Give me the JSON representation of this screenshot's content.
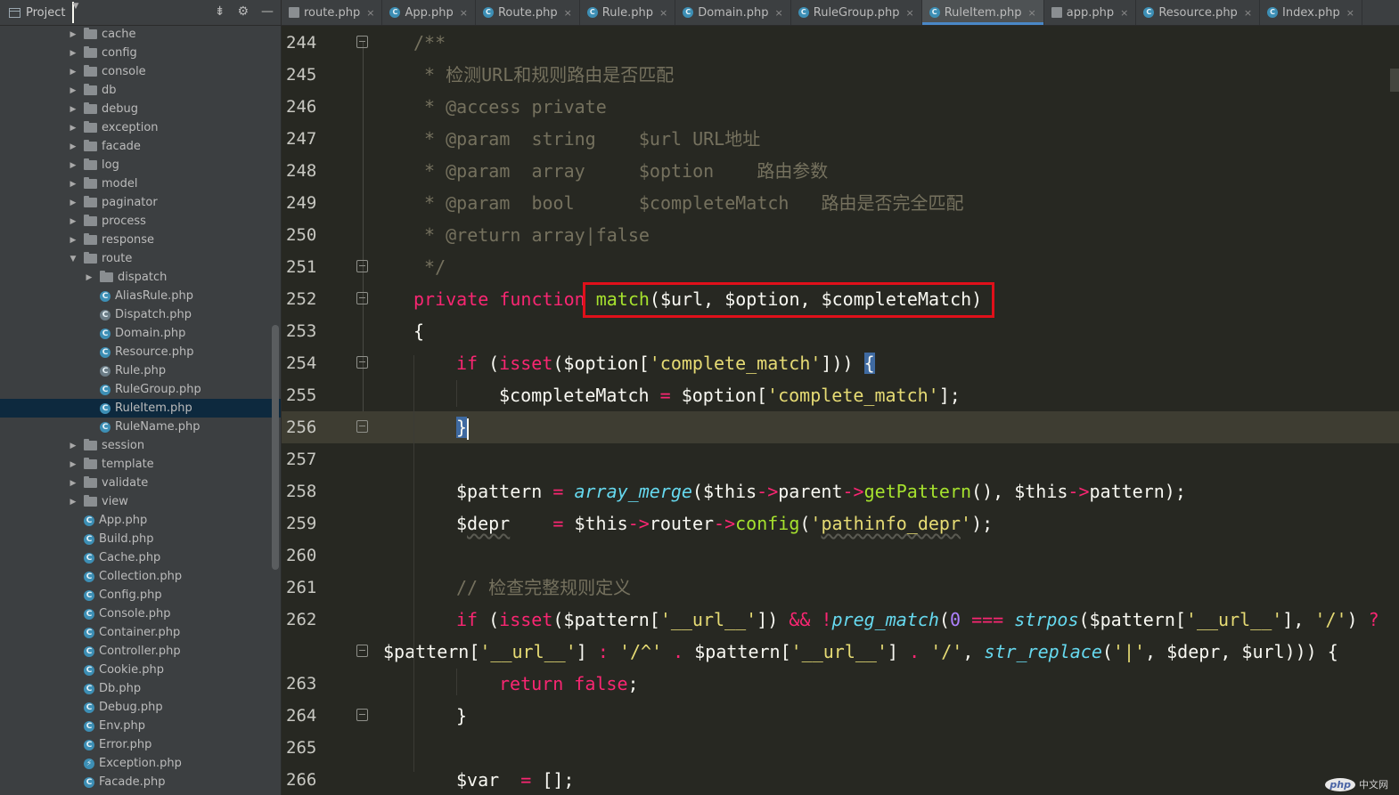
{
  "sidebar": {
    "title": "Project",
    "items": [
      {
        "type": "folder",
        "label": "cache",
        "indent": 1,
        "expanded": false
      },
      {
        "type": "folder",
        "label": "config",
        "indent": 1,
        "expanded": false
      },
      {
        "type": "folder",
        "label": "console",
        "indent": 1,
        "expanded": false
      },
      {
        "type": "folder",
        "label": "db",
        "indent": 1,
        "expanded": false
      },
      {
        "type": "folder",
        "label": "debug",
        "indent": 1,
        "expanded": false
      },
      {
        "type": "folder",
        "label": "exception",
        "indent": 1,
        "expanded": false
      },
      {
        "type": "folder",
        "label": "facade",
        "indent": 1,
        "expanded": false
      },
      {
        "type": "folder",
        "label": "log",
        "indent": 1,
        "expanded": false
      },
      {
        "type": "folder",
        "label": "model",
        "indent": 1,
        "expanded": false
      },
      {
        "type": "folder",
        "label": "paginator",
        "indent": 1,
        "expanded": false
      },
      {
        "type": "folder",
        "label": "process",
        "indent": 1,
        "expanded": false
      },
      {
        "type": "folder",
        "label": "response",
        "indent": 1,
        "expanded": false
      },
      {
        "type": "folder",
        "label": "route",
        "indent": 1,
        "expanded": true
      },
      {
        "type": "folder",
        "label": "dispatch",
        "indent": 2,
        "expanded": false
      },
      {
        "type": "class",
        "label": "AliasRule.php",
        "indent": 2
      },
      {
        "type": "abstract",
        "label": "Dispatch.php",
        "indent": 2
      },
      {
        "type": "class",
        "label": "Domain.php",
        "indent": 2
      },
      {
        "type": "class",
        "label": "Resource.php",
        "indent": 2
      },
      {
        "type": "abstract",
        "label": "Rule.php",
        "indent": 2
      },
      {
        "type": "class",
        "label": "RuleGroup.php",
        "indent": 2
      },
      {
        "type": "class",
        "label": "RuleItem.php",
        "indent": 2,
        "selected": true
      },
      {
        "type": "class",
        "label": "RuleName.php",
        "indent": 2
      },
      {
        "type": "folder",
        "label": "session",
        "indent": 1,
        "expanded": false
      },
      {
        "type": "folder",
        "label": "template",
        "indent": 1,
        "expanded": false
      },
      {
        "type": "folder",
        "label": "validate",
        "indent": 1,
        "expanded": false
      },
      {
        "type": "folder",
        "label": "view",
        "indent": 1,
        "expanded": false
      },
      {
        "type": "class",
        "label": "App.php",
        "indent": 1
      },
      {
        "type": "class",
        "label": "Build.php",
        "indent": 1
      },
      {
        "type": "class",
        "label": "Cache.php",
        "indent": 1
      },
      {
        "type": "class",
        "label": "Collection.php",
        "indent": 1
      },
      {
        "type": "class",
        "label": "Config.php",
        "indent": 1
      },
      {
        "type": "class",
        "label": "Console.php",
        "indent": 1
      },
      {
        "type": "class",
        "label": "Container.php",
        "indent": 1
      },
      {
        "type": "class",
        "label": "Controller.php",
        "indent": 1
      },
      {
        "type": "class",
        "label": "Cookie.php",
        "indent": 1
      },
      {
        "type": "class",
        "label": "Db.php",
        "indent": 1
      },
      {
        "type": "class",
        "label": "Debug.php",
        "indent": 1
      },
      {
        "type": "class",
        "label": "Env.php",
        "indent": 1
      },
      {
        "type": "class",
        "label": "Error.php",
        "indent": 1
      },
      {
        "type": "exception",
        "label": "Exception.php",
        "indent": 1
      },
      {
        "type": "class",
        "label": "Facade.php",
        "indent": 1
      }
    ]
  },
  "tabs": [
    {
      "label": "route.php",
      "icon": "file"
    },
    {
      "label": "App.php",
      "icon": "class"
    },
    {
      "label": "Route.php",
      "icon": "class"
    },
    {
      "label": "Rule.php",
      "icon": "abstract"
    },
    {
      "label": "Domain.php",
      "icon": "class"
    },
    {
      "label": "RuleGroup.php",
      "icon": "class"
    },
    {
      "label": "RuleItem.php",
      "icon": "class",
      "active": true
    },
    {
      "label": "app.php",
      "icon": "file"
    },
    {
      "label": "Resource.php",
      "icon": "class"
    },
    {
      "label": "Index.php",
      "icon": "class"
    }
  ],
  "editor": {
    "lines": [
      {
        "n": "244",
        "fold": true,
        "tokens": [
          [
            "cm",
            "/**"
          ]
        ],
        "indent": 1
      },
      {
        "n": "245",
        "tokens": [
          [
            "cm",
            " * 检测URL和规则路由是否匹配"
          ]
        ],
        "indent": 1
      },
      {
        "n": "246",
        "tokens": [
          [
            "cm",
            " * @access private"
          ]
        ],
        "indent": 1
      },
      {
        "n": "247",
        "tokens": [
          [
            "cm",
            " * @param  string    $url URL地址"
          ]
        ],
        "indent": 1
      },
      {
        "n": "248",
        "tokens": [
          [
            "cm",
            " * @param  array     $option    路由参数"
          ]
        ],
        "indent": 1
      },
      {
        "n": "249",
        "tokens": [
          [
            "cm",
            " * @param  bool      $completeMatch   路由是否完全匹配"
          ]
        ],
        "indent": 1
      },
      {
        "n": "250",
        "tokens": [
          [
            "cm",
            " * @return array|false"
          ]
        ],
        "indent": 1
      },
      {
        "n": "251",
        "fold": true,
        "tokens": [
          [
            "cm",
            " */"
          ]
        ],
        "indent": 1
      },
      {
        "n": "252",
        "fold": true,
        "tokens": [
          [
            "kw",
            "private function "
          ],
          [
            "fn",
            "match"
          ],
          [
            "va",
            "($url, $option, $completeMatch)"
          ]
        ],
        "indent": 1
      },
      {
        "n": "253",
        "tokens": [
          [
            "va",
            "{"
          ]
        ],
        "indent": 1
      },
      {
        "n": "254",
        "fold": true,
        "tokens": [
          [
            "kw",
            "if "
          ],
          [
            "va",
            "("
          ],
          [
            "bi2",
            "isset"
          ],
          [
            "va",
            "($option["
          ],
          [
            "st",
            "'complete_match'"
          ],
          [
            "va",
            "])) "
          ],
          [
            "brhl",
            "{"
          ]
        ],
        "indent": 2
      },
      {
        "n": "255",
        "tokens": [
          [
            "va",
            "$completeMatch "
          ],
          [
            "op",
            "="
          ],
          [
            "va",
            " $option["
          ],
          [
            "st",
            "'complete_match'"
          ],
          [
            "va",
            "];"
          ]
        ],
        "indent": 3
      },
      {
        "n": "256",
        "fold": true,
        "current": true,
        "tokens": [
          [
            "brhl",
            "}"
          ],
          [
            "caret",
            ""
          ]
        ],
        "indent": 2
      },
      {
        "n": "257",
        "tokens": [],
        "indent": 2
      },
      {
        "n": "258",
        "tokens": [
          [
            "va",
            "$pattern "
          ],
          [
            "op",
            "="
          ],
          [
            "va",
            " "
          ],
          [
            "bi",
            "array_merge"
          ],
          [
            "va",
            "($this"
          ],
          [
            "op",
            "->"
          ],
          [
            "va",
            "parent"
          ],
          [
            "op",
            "->"
          ],
          [
            "fn",
            "getPattern"
          ],
          [
            "va",
            "(), $this"
          ],
          [
            "op",
            "->"
          ],
          [
            "va",
            "pattern);"
          ]
        ],
        "indent": 2
      },
      {
        "n": "259",
        "tokens": [
          [
            "va",
            "$"
          ],
          [
            "sq",
            "depr"
          ],
          [
            "va",
            "    "
          ],
          [
            "op",
            "="
          ],
          [
            "va",
            " $this"
          ],
          [
            "op",
            "->"
          ],
          [
            "va",
            "router"
          ],
          [
            "op",
            "->"
          ],
          [
            "fn",
            "config"
          ],
          [
            "va",
            "("
          ],
          [
            "st",
            "'"
          ],
          [
            "stsq",
            "pathinfo_depr"
          ],
          [
            "st",
            "'"
          ],
          [
            "va",
            ");"
          ]
        ],
        "indent": 2
      },
      {
        "n": "260",
        "tokens": [],
        "indent": 2
      },
      {
        "n": "261",
        "tokens": [
          [
            "cm",
            "// 检查完整规则定义"
          ]
        ],
        "indent": 2
      },
      {
        "n": "262",
        "tokens": [
          [
            "kw",
            "if "
          ],
          [
            "va",
            "("
          ],
          [
            "bi2",
            "isset"
          ],
          [
            "va",
            "($pattern["
          ],
          [
            "st",
            "'__url__'"
          ],
          [
            "va",
            "]) "
          ],
          [
            "op",
            "&&"
          ],
          [
            "va",
            " "
          ],
          [
            "op",
            "!"
          ],
          [
            "bi",
            "preg_match"
          ],
          [
            "va",
            "("
          ],
          [
            "nu",
            "0"
          ],
          [
            "va",
            " "
          ],
          [
            "op",
            "==="
          ],
          [
            "va",
            " "
          ],
          [
            "bi",
            "strpos"
          ],
          [
            "va",
            "($pattern["
          ],
          [
            "st",
            "'__url__'"
          ],
          [
            "va",
            "], "
          ],
          [
            "st",
            "'/'"
          ],
          [
            "va",
            ") "
          ],
          [
            "op",
            "?"
          ]
        ],
        "indent": 2
      },
      {
        "n": "",
        "wrap": true,
        "fold": true,
        "tokens": [
          [
            "va",
            "$pattern["
          ],
          [
            "st",
            "'__url__'"
          ],
          [
            "va",
            "] "
          ],
          [
            "op",
            ":"
          ],
          [
            "va",
            " "
          ],
          [
            "st",
            "'/^'"
          ],
          [
            "va",
            " "
          ],
          [
            "op",
            "."
          ],
          [
            "va",
            " $pattern["
          ],
          [
            "st",
            "'__url__'"
          ],
          [
            "va",
            "] "
          ],
          [
            "op",
            "."
          ],
          [
            "va",
            " "
          ],
          [
            "st",
            "'/'"
          ],
          [
            "va",
            ", "
          ],
          [
            "bi",
            "str_replace"
          ],
          [
            "va",
            "("
          ],
          [
            "st",
            "'|'"
          ],
          [
            "va",
            ", $depr, $url))) {"
          ]
        ],
        "indent": 0
      },
      {
        "n": "263",
        "tokens": [
          [
            "kw",
            "return false"
          ],
          [
            "va",
            ";"
          ]
        ],
        "indent": 3
      },
      {
        "n": "264",
        "fold": true,
        "tokens": [
          [
            "va",
            "}"
          ]
        ],
        "indent": 2
      },
      {
        "n": "265",
        "tokens": [],
        "indent": 2
      },
      {
        "n": "266",
        "tokens": [
          [
            "va",
            "$var  "
          ],
          [
            "op",
            "="
          ],
          [
            "va",
            " [];"
          ]
        ],
        "indent": 2
      }
    ]
  },
  "watermark": {
    "logo": "php",
    "text": "中文网"
  }
}
